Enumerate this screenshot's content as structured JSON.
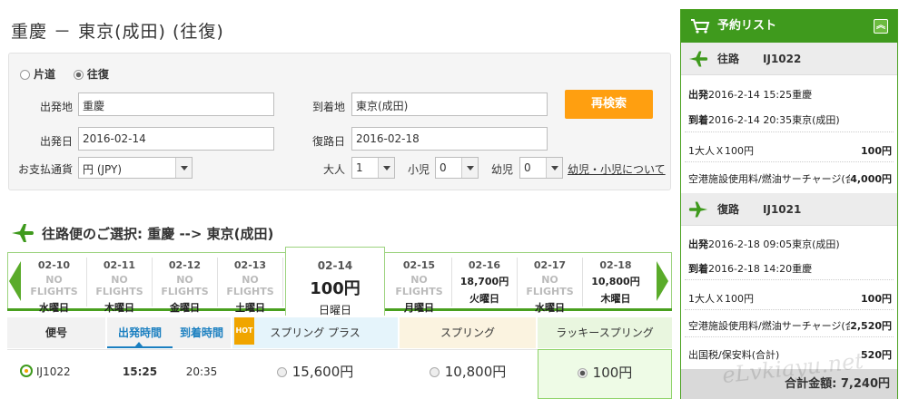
{
  "page": {
    "title": "重慶 － 東京(成田) (往復)"
  },
  "search": {
    "oneway_label": "片道",
    "roundtrip_label": "往復",
    "origin_label": "出発地",
    "origin_value": "重慶",
    "dest_label": "到着地",
    "dest_value": "東京(成田)",
    "depart_label": "出発日",
    "depart_value": "2016-02-14",
    "return_label": "復路日",
    "return_value": "2016-02-18",
    "currency_label": "お支払通貨",
    "currency_value": "円 (JPY)",
    "adult_label": "大人",
    "adult_value": "1",
    "child_label": "小児",
    "child_value": "0",
    "infant_label": "幼児",
    "infant_value": "0",
    "kids_link": "幼児・小児について",
    "research_button": "再検索"
  },
  "outbound": {
    "heading": "往路便のご選択: 重慶 --> 東京(成田)",
    "dates": [
      {
        "date": "02-10",
        "price": "NO FLIGHTS",
        "weekday": "水曜日"
      },
      {
        "date": "02-11",
        "price": "NO FLIGHTS",
        "weekday": "木曜日"
      },
      {
        "date": "02-12",
        "price": "NO FLIGHTS",
        "weekday": "金曜日"
      },
      {
        "date": "02-13",
        "price": "NO FLIGHTS",
        "weekday": "土曜日"
      },
      {
        "date": "02-14",
        "price": "100円",
        "weekday": "日曜日"
      },
      {
        "date": "02-15",
        "price": "NO FLIGHTS",
        "weekday": "月曜日"
      },
      {
        "date": "02-16",
        "price": "18,700円",
        "weekday": "火曜日"
      },
      {
        "date": "02-17",
        "price": "NO FLIGHTS",
        "weekday": "水曜日"
      },
      {
        "date": "02-18",
        "price": "10,800円",
        "weekday": "木曜日"
      }
    ],
    "columns": {
      "flight": "便号",
      "depart": "出発時間",
      "arrive": "到着時間",
      "hot_badge": "HOT",
      "fare1": "スプリング プラス",
      "fare2": "スプリング",
      "fare3": "ラッキースプリング"
    },
    "row": {
      "flight": "IJ1022",
      "depart": "15:25",
      "arrive": "20:35",
      "fare1": "15,600円",
      "fare2": "10,800円",
      "fare3": "100円"
    }
  },
  "sidebar": {
    "title": "予約リスト",
    "outbound_label": "往路",
    "outbound_flight": "IJ1022",
    "outbound_dep_key": "出発",
    "outbound_dep": "2016-2-14 15:25重慶",
    "outbound_arr_key": "到着",
    "outbound_arr": "2016-2-14 20:35東京(成田)",
    "outbound_fare_label": "1大人Ｘ100円",
    "outbound_fare": "100円",
    "outbound_fee_label": "空港施設使用料/燃油サーチャージ(合計)",
    "outbound_fee": "4,000円",
    "return_label": "復路",
    "return_flight": "IJ1021",
    "return_dep_key": "出発",
    "return_dep": "2016-2-18 09:05東京(成田)",
    "return_arr_key": "到着",
    "return_arr": "2016-2-18 14:20重慶",
    "return_fare_label": "1大人Ｘ100円",
    "return_fare": "100円",
    "return_fee_label": "空港施設使用料/燃油サーチャージ(合計)",
    "return_fee": "2,520円",
    "tax_label": "出国税/保安料(合計)",
    "tax": "520円",
    "total_label": "合計金額:",
    "total": "7,240円"
  },
  "watermark": "eLvkiayu.net",
  "colors": {
    "accent_green": "#3f9a1d",
    "orange": "#ff9f10",
    "fare_blue_bg": "#e5f4fb",
    "fare_tan_bg": "#fbf3e0",
    "fare_green_bg": "#e9f6df"
  }
}
